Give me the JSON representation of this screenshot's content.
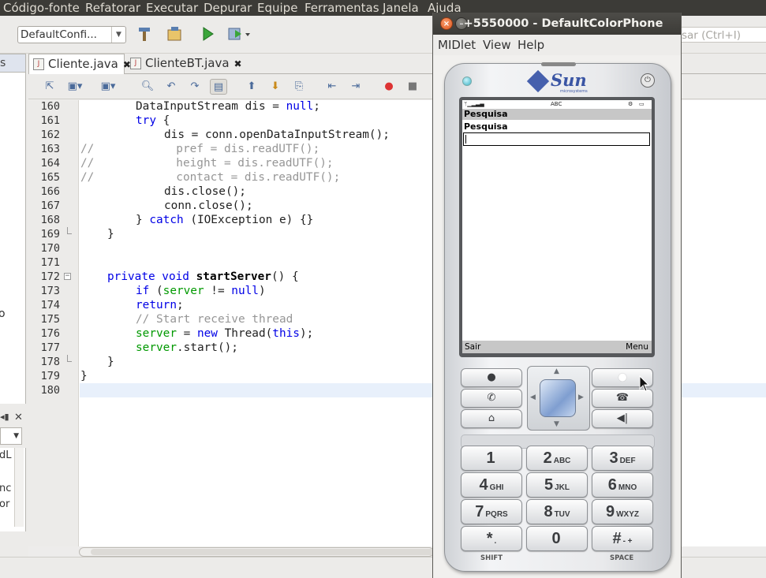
{
  "menubar": {
    "items": [
      "Código-fonte",
      "Refatorar",
      "Executar",
      "Depurar",
      "Equipe",
      "Ferramentas",
      "Janela",
      "Ajuda"
    ]
  },
  "toolbar": {
    "config_value": "DefaultConfi...",
    "search_placeholder": "sar (Ctrl+I)"
  },
  "left_panel": {
    "tab_label": "s",
    "fragment": "o",
    "nav_fragments": [
      "dL",
      "nc",
      "or"
    ]
  },
  "editor": {
    "tabs": [
      {
        "label": "Cliente.java",
        "active": true
      },
      {
        "label": "ClienteBT.java",
        "active": false
      }
    ],
    "line_numbers": [
      "160",
      "161",
      "162",
      "163",
      "164",
      "165",
      "166",
      "167",
      "168",
      "169",
      "170",
      "171",
      "172",
      "173",
      "174",
      "175",
      "176",
      "177",
      "178",
      "179",
      "180"
    ],
    "code": {
      "l160": "DataInputStream dis = ",
      "l160_kw": "null",
      "l161_kw": "try",
      "l162": "dis = conn.openDataInputStream();",
      "l163": "//            pref = dis.readUTF();",
      "l164": "//            height = dis.readUTF();",
      "l165": "//            contact = dis.readUTF();",
      "l166": "dis.close();",
      "l167": "conn.close();",
      "l168_kw": "catch",
      "l168": " (IOException e) {}",
      "l172_kw": "private void ",
      "l172_meth": "startServer",
      "l172": "() {",
      "l173_kw": "if",
      "l173_fld": "server",
      "l173_kw2": "null",
      "l174_kw": "return",
      "l175": "// Start receive thread",
      "l176_fld": "server",
      "l176_kw": "new",
      "l176": " Thread(",
      "l176_kw2": "this",
      "l177_fld": "server",
      "l177": ".start();"
    }
  },
  "emulator": {
    "title": "+5550000 - DefaultColorPhone",
    "menu": [
      "MIDlet",
      "View",
      "Help"
    ],
    "brand": "Sun",
    "brand_sub": "microsystems",
    "screen": {
      "status_mode": "ABC",
      "title": "Pesquisa",
      "field_label": "Pesquisa",
      "field_value": "",
      "soft_left": "Sair",
      "soft_right": "Menu"
    },
    "keys": [
      {
        "digit": "1",
        "letters": ""
      },
      {
        "digit": "2",
        "letters": "ABC"
      },
      {
        "digit": "3",
        "letters": "DEF"
      },
      {
        "digit": "4",
        "letters": "GHI"
      },
      {
        "digit": "5",
        "letters": "JKL"
      },
      {
        "digit": "6",
        "letters": "MNO"
      },
      {
        "digit": "7",
        "letters": "PQRS"
      },
      {
        "digit": "8",
        "letters": "TUV"
      },
      {
        "digit": "9",
        "letters": "WXYZ"
      },
      {
        "digit": "*",
        "letters": "."
      },
      {
        "digit": "0",
        "letters": ""
      },
      {
        "digit": "#",
        "letters": "- +"
      }
    ],
    "shift_label": "SHIFT",
    "space_label": "SPACE"
  }
}
